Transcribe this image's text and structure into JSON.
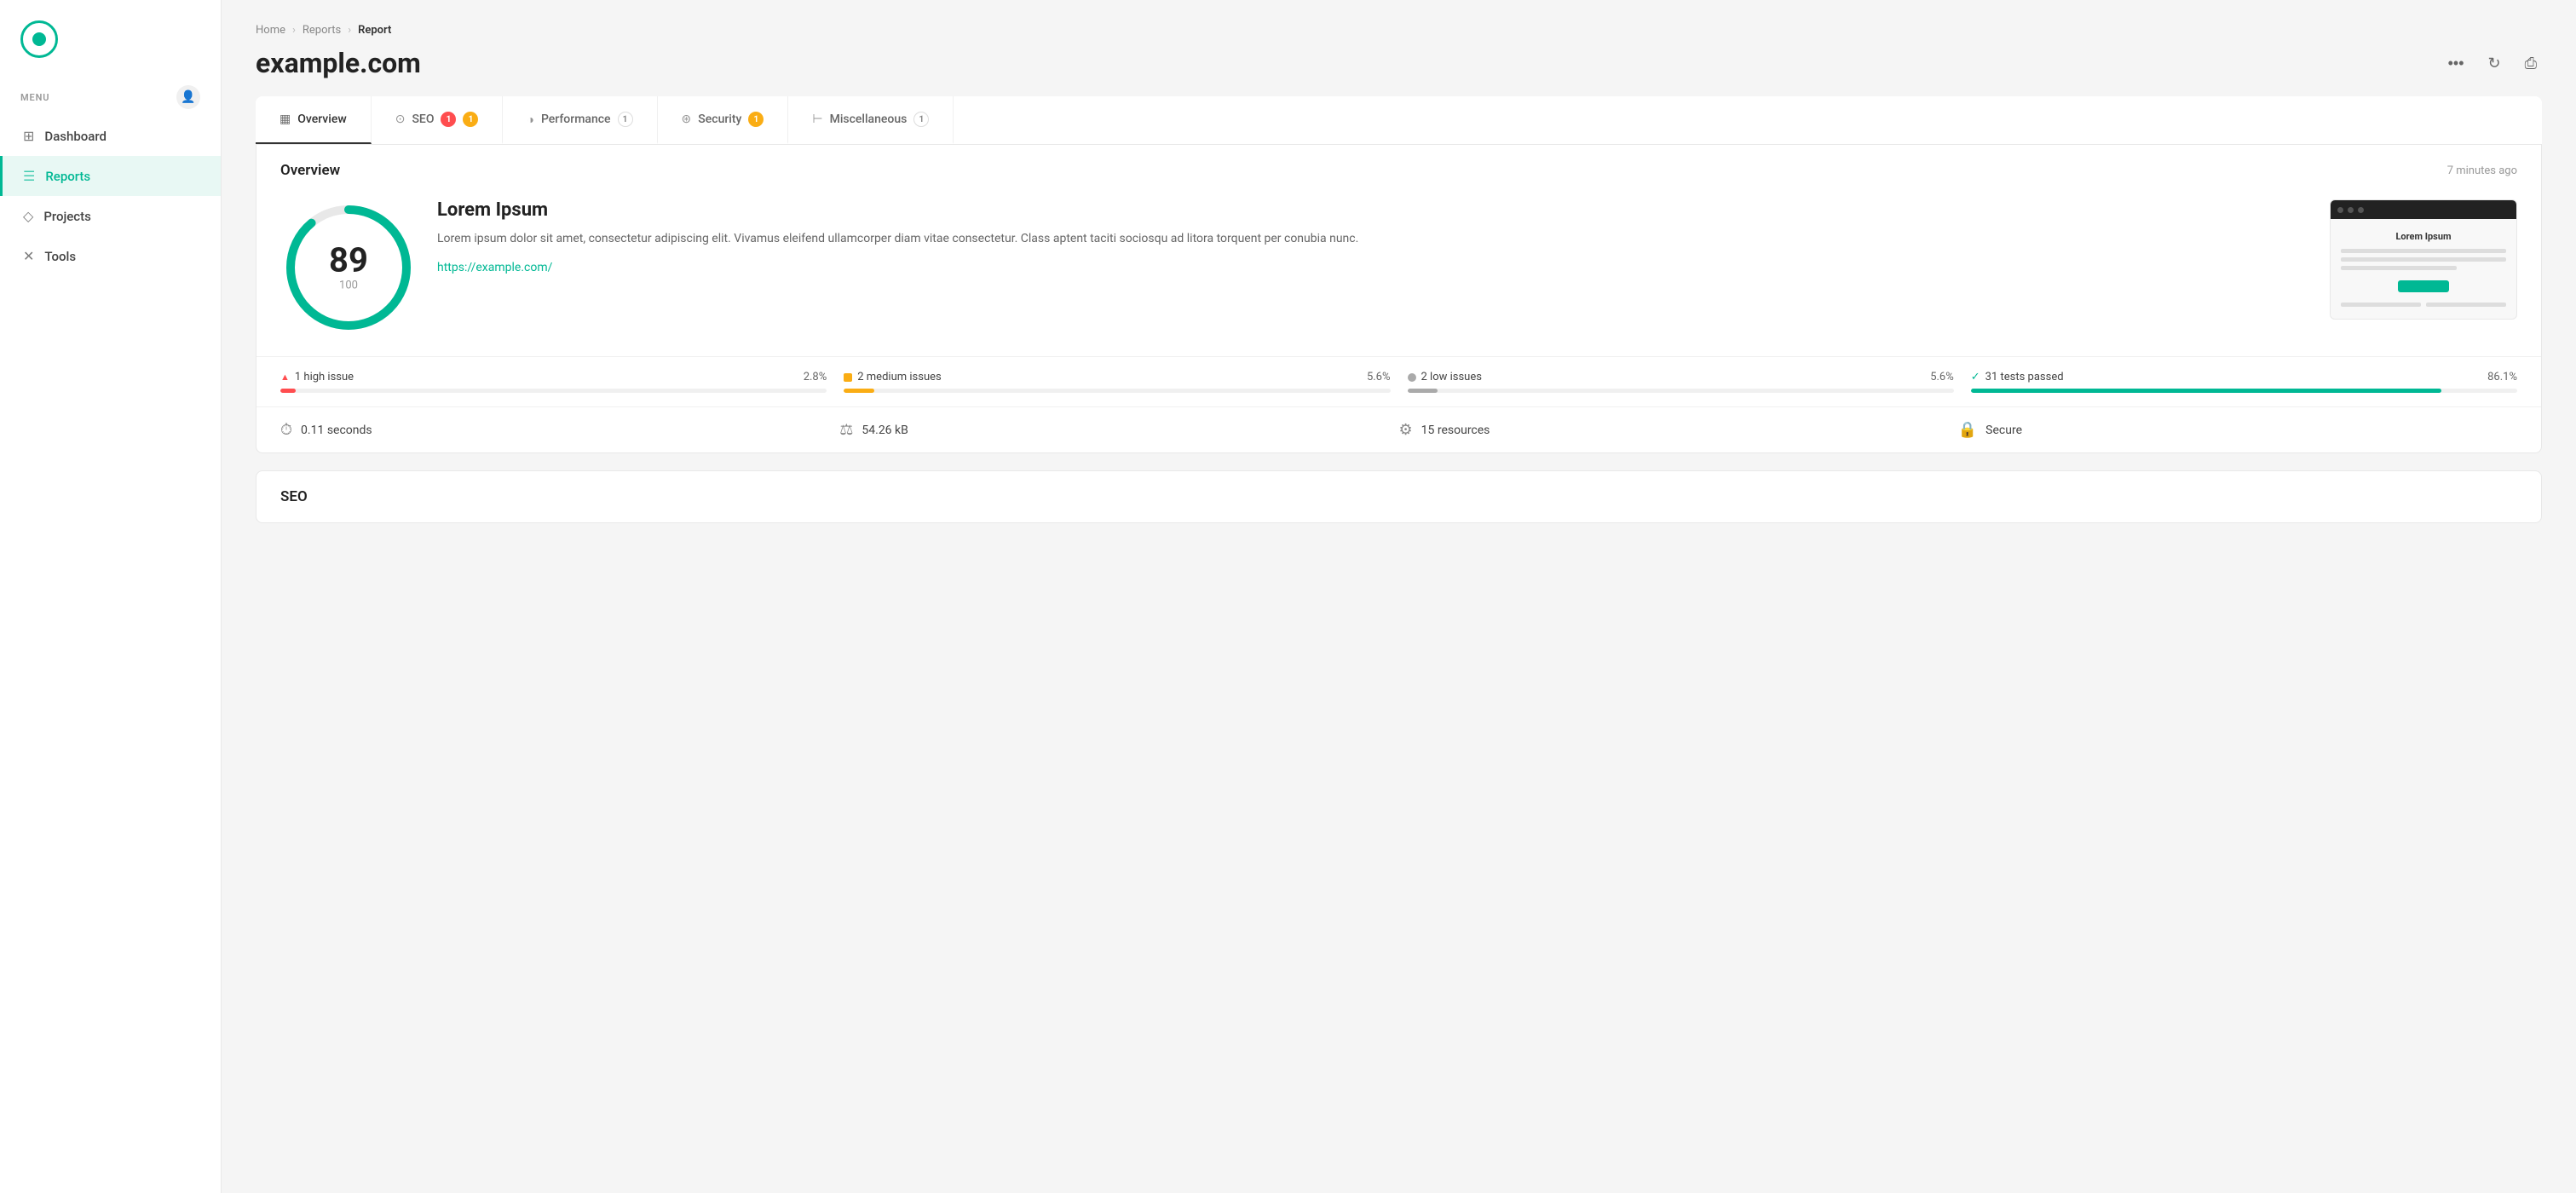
{
  "sidebar": {
    "menu_label": "MENU",
    "nav_items": [
      {
        "id": "dashboard",
        "label": "Dashboard",
        "icon": "⊞",
        "active": false
      },
      {
        "id": "reports",
        "label": "Reports",
        "icon": "☰",
        "active": true
      },
      {
        "id": "projects",
        "label": "Projects",
        "icon": "◇",
        "active": false
      },
      {
        "id": "tools",
        "label": "Tools",
        "icon": "✕",
        "active": false
      }
    ]
  },
  "breadcrumb": {
    "items": [
      "Home",
      "Reports",
      "Report"
    ]
  },
  "page": {
    "title": "example.com"
  },
  "header_actions": {
    "more_label": "•••",
    "refresh_label": "↻",
    "print_label": "⎙"
  },
  "tabs": [
    {
      "id": "overview",
      "label": "Overview",
      "icon": "▦",
      "active": true,
      "badge": null,
      "badge_type": null
    },
    {
      "id": "seo",
      "label": "SEO",
      "icon": "⊙",
      "active": false,
      "badge": "1",
      "badge2": "1",
      "badge_type": "dual"
    },
    {
      "id": "performance",
      "label": "Performance",
      "icon": "◑",
      "active": false,
      "badge": "1",
      "badge_type": "outline"
    },
    {
      "id": "security",
      "label": "Security",
      "icon": "⊛",
      "active": false,
      "badge": "1",
      "badge_type": "yellow"
    },
    {
      "id": "miscellaneous",
      "label": "Miscellaneous",
      "icon": "⊢",
      "active": false,
      "badge": "1",
      "badge_type": "outline"
    }
  ],
  "overview": {
    "title": "Overview",
    "time_ago": "7 minutes ago",
    "score": {
      "value": 89,
      "max": 100,
      "percentage": 89
    },
    "site": {
      "name": "Lorem Ipsum",
      "description": "Lorem ipsum dolor sit amet, consectetur adipiscing elit. Vivamus eleifend ullamcorper diam vitae consectetur. Class aptent taciti sociosqu ad litora torquent per conubia nunc.",
      "url": "https://example.com/"
    },
    "preview": {
      "title": "Lorem Ipsum",
      "btn_label": ""
    },
    "issues": [
      {
        "id": "high",
        "icon": "▲",
        "label": "1 high issue",
        "pct": "2.8%",
        "fill_pct": 2.8,
        "type": "red"
      },
      {
        "id": "medium",
        "label": "2 medium issues",
        "pct": "5.6%",
        "fill_pct": 5.6,
        "type": "yellow"
      },
      {
        "id": "low",
        "label": "2 low issues",
        "pct": "5.6%",
        "fill_pct": 5.6,
        "type": "gray"
      },
      {
        "id": "passed",
        "label": "31 tests passed",
        "pct": "86.1%",
        "fill_pct": 86.1,
        "type": "green"
      }
    ],
    "stats": [
      {
        "id": "time",
        "icon": "⏱",
        "label": "0.11 seconds"
      },
      {
        "id": "size",
        "icon": "⚖",
        "label": "54.26 kB"
      },
      {
        "id": "resources",
        "icon": "⚙",
        "label": "15 resources"
      },
      {
        "id": "secure",
        "icon": "🔒",
        "label": "Secure"
      }
    ]
  },
  "seo_section": {
    "title": "SEO"
  }
}
